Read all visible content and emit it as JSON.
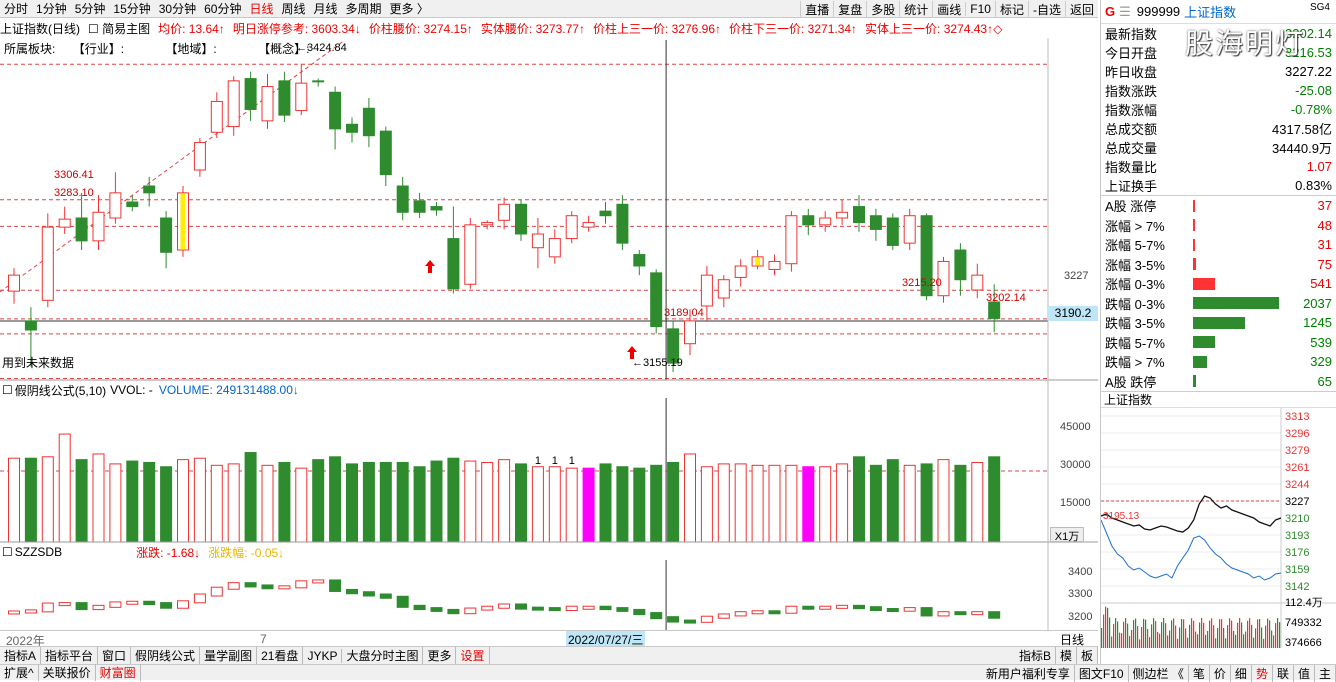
{
  "toolbar": {
    "periods": [
      "分时",
      "1分钟",
      "5分钟",
      "15分钟",
      "30分钟",
      "60分钟",
      "日线",
      "周线",
      "月线",
      "多周期",
      "更多 〉"
    ],
    "active_period": "日线",
    "right": [
      "直播",
      "复盘",
      "多股",
      "统计",
      "画线",
      "F10",
      "标记",
      "-自选",
      "返回"
    ]
  },
  "info": {
    "name": "上证指数(日线)",
    "chart_mode": "简易主图",
    "items": [
      {
        "text": "均价: 13.64↑",
        "color": "red"
      },
      {
        "text": "明日涨停参考: 3603.34↓",
        "color": "red"
      },
      {
        "text": "价柱腰价: 3274.15↑",
        "color": "red"
      },
      {
        "text": "实体腰价: 3273.77↑",
        "color": "red"
      },
      {
        "text": "价柱上三一价: 3276.96↑",
        "color": "red"
      },
      {
        "text": "价柱下三一价: 3271.34↑",
        "color": "red"
      },
      {
        "text": "实体上三一价: 3274.43↑◇",
        "color": "red"
      }
    ]
  },
  "sector": {
    "label": "所属板块:",
    "industry": "【行业】:",
    "region": "【地域】:",
    "concept": "【概念】:"
  },
  "main_notes": {
    "future_data": "用到未来数据",
    "crosshair_price": "3190.2",
    "axis_3227": "3227"
  },
  "annotations": {
    "high": "←3424.84",
    "low": "←3155.19",
    "l1": "3306.41",
    "l2": "3283.10",
    "l3": "3189.04",
    "l4": "3215.20",
    "l5": "3202.14"
  },
  "vol": {
    "title": "假阴线公式(5,10)",
    "vvol": "VVOL: -",
    "volume": "VOLUME: 249131488.00↓",
    "ticks": [
      "45000",
      "30000",
      "15000"
    ],
    "unit": "X1万",
    "marker": "1"
  },
  "szz": {
    "title": "SZZSDB",
    "change": "涨跌: -1.68↓",
    "change_pct": "涨跌幅: -0.05↓",
    "ticks": [
      "3400",
      "3300",
      "3200"
    ],
    "year": "2022年",
    "month": "7",
    "date": "2022/07/27/三",
    "period": "日线"
  },
  "bottom": {
    "tabs": [
      "指标A",
      "指标平台",
      "窗口",
      "假阴线公式",
      "量学副图",
      "21看盘",
      "JYKP",
      "大盘分时主图",
      "更多",
      "设置"
    ],
    "right_tabs": [
      "指标B",
      "模",
      "板"
    ],
    "tabs2": [
      "扩展^",
      "关联报价",
      "财富圈"
    ],
    "right2": [
      "新用户福利专享",
      "图文F10",
      "侧边栏 《",
      "笔",
      "价",
      "细",
      "势",
      "联",
      "值",
      "主"
    ]
  },
  "right_panel": {
    "code": "999999",
    "name": "上证指数",
    "g": "G",
    "tag": "SG4",
    "stats": [
      {
        "k": "最新指数",
        "v": "3202.14",
        "color": "green"
      },
      {
        "k": "今日开盘",
        "v": "3216.53",
        "color": "green"
      },
      {
        "k": "昨日收盘",
        "v": "3227.22",
        "color": "black"
      },
      {
        "k": "指数涨跌",
        "v": "-25.08",
        "color": "green"
      },
      {
        "k": "指数涨幅",
        "v": "-0.78%",
        "color": "green"
      },
      {
        "k": "总成交额",
        "v": "4317.58亿",
        "color": "black"
      },
      {
        "k": "总成交量",
        "v": "34440.9万",
        "color": "black"
      },
      {
        "k": "指数量比",
        "v": "1.07",
        "color": "red"
      },
      {
        "k": "上证换手",
        "v": "0.83%",
        "color": "black"
      }
    ],
    "breadth": [
      {
        "k": "A股 涨停",
        "v": "37",
        "color": "red",
        "w": 1.8
      },
      {
        "k": "涨幅 > 7%",
        "v": "48",
        "color": "red",
        "w": 2.3
      },
      {
        "k": "涨幅 5-7%",
        "v": "31",
        "color": "red",
        "w": 1.5
      },
      {
        "k": "涨幅 3-5%",
        "v": "75",
        "color": "red",
        "w": 3.6
      },
      {
        "k": "涨幅 0-3%",
        "v": "541",
        "color": "red",
        "w": 26
      },
      {
        "k": "跌幅 0-3%",
        "v": "2037",
        "color": "green",
        "w": 100
      },
      {
        "k": "跌幅 3-5%",
        "v": "1245",
        "color": "green",
        "w": 61
      },
      {
        "k": "跌幅 5-7%",
        "v": "539",
        "color": "green",
        "w": 26
      },
      {
        "k": "跌幅 > 7%",
        "v": "329",
        "color": "green",
        "w": 16
      },
      {
        "k": "A股 跌停",
        "v": "65",
        "color": "green",
        "w": 3
      }
    ],
    "mini_title": "上证指数",
    "mini_ticks": [
      "3313",
      "3296",
      "3279",
      "3261",
      "3244",
      "3227",
      "3210",
      "3193",
      "3176",
      "3159",
      "3142"
    ],
    "mini_left": "3195.13",
    "mini_vol_ticks": [
      "112.4万",
      "749332",
      "374666"
    ]
  },
  "chart_data": {
    "type": "candlestick",
    "price_range": [
      3150,
      3430
    ],
    "dashed_levels": [
      3306.41,
      3283.1,
      3227.22,
      3202.14,
      3189.04
    ],
    "crosshair_index": 39,
    "candles": [
      [
        3240,
        3226,
        3246,
        3215
      ],
      [
        3200,
        3192,
        3212,
        3160
      ],
      [
        3218,
        3282,
        3294,
        3212
      ],
      [
        3282,
        3289,
        3300,
        3276
      ],
      [
        3290,
        3270,
        3312,
        3262
      ],
      [
        3270,
        3295,
        3310,
        3262
      ],
      [
        3290,
        3312,
        3330,
        3285
      ],
      [
        3304,
        3300,
        3310,
        3296
      ],
      [
        3318,
        3312,
        3326,
        3300
      ],
      [
        3290,
        3260,
        3296,
        3246
      ],
      [
        3262,
        3312,
        3318,
        3256
      ],
      [
        3332,
        3356,
        3360,
        3326
      ],
      [
        3365,
        3392,
        3400,
        3360
      ],
      [
        3370,
        3410,
        3414,
        3362
      ],
      [
        3412,
        3385,
        3418,
        3375
      ],
      [
        3375,
        3405,
        3416,
        3368
      ],
      [
        3410,
        3380,
        3418,
        3374
      ],
      [
        3384,
        3408,
        3424.84,
        3380
      ],
      [
        3410,
        3410,
        3412,
        3405
      ],
      [
        3400,
        3368,
        3405,
        3350
      ],
      [
        3372,
        3365,
        3378,
        3356
      ],
      [
        3386,
        3362,
        3395,
        3352
      ],
      [
        3366,
        3328,
        3370,
        3318
      ],
      [
        3318,
        3295,
        3326,
        3288
      ],
      [
        3305,
        3295,
        3312,
        3290
      ],
      [
        3300,
        3297,
        3304,
        3292
      ],
      [
        3272,
        3228,
        3300,
        3224
      ],
      [
        3232,
        3284,
        3290,
        3228
      ],
      [
        3284,
        3286,
        3288,
        3280
      ],
      [
        3288,
        3302,
        3308,
        3280
      ],
      [
        3302,
        3276,
        3306,
        3270
      ],
      [
        3276,
        3264,
        3290,
        3246
      ],
      [
        3256,
        3272,
        3280,
        3250
      ],
      [
        3272,
        3292,
        3296,
        3268
      ],
      [
        3282,
        3286,
        3292,
        3278
      ],
      [
        3296,
        3292,
        3304,
        3285
      ],
      [
        3302,
        3268,
        3310,
        3262
      ],
      [
        3258,
        3248,
        3262,
        3240
      ],
      [
        3242,
        3195,
        3245,
        3189
      ],
      [
        3193,
        3163,
        3200,
        3155.19
      ],
      [
        3180,
        3200,
        3210,
        3170
      ],
      [
        3213,
        3240,
        3248,
        3200
      ],
      [
        3220,
        3236,
        3240,
        3212
      ],
      [
        3238,
        3248,
        3254,
        3230
      ],
      [
        3248,
        3256,
        3262,
        3245
      ],
      [
        3245,
        3252,
        3258,
        3240
      ],
      [
        3250,
        3292,
        3296,
        3243
      ],
      [
        3292,
        3284,
        3298,
        3275
      ],
      [
        3284,
        3290,
        3296,
        3278
      ],
      [
        3290,
        3295,
        3306,
        3284
      ],
      [
        3300,
        3286,
        3310,
        3278
      ],
      [
        3292,
        3280,
        3298,
        3270
      ],
      [
        3290,
        3266,
        3294,
        3262
      ],
      [
        3268,
        3292,
        3298,
        3262
      ],
      [
        3292,
        3222,
        3294,
        3218
      ],
      [
        3222,
        3252,
        3256,
        3216
      ],
      [
        3262,
        3236,
        3268,
        3222
      ],
      [
        3227,
        3240,
        3250,
        3220
      ],
      [
        3216.53,
        3202.14,
        3232,
        3190
      ]
    ],
    "candle_colors": {
      "0": "up",
      "10": "up",
      "31": "up",
      "32": "up",
      "40": "up",
      "41": "up",
      "42": "up",
      "45": "up",
      "48": "up",
      "53": "up",
      "55": "up",
      "57": "up"
    },
    "volumes": [
      29500,
      29500,
      30000,
      38000,
      29000,
      31000,
      27500,
      28500,
      28000,
      26500,
      29000,
      29500,
      27000,
      27500,
      31500,
      27000,
      28000,
      26000,
      29000,
      30000,
      27500,
      28000,
      28000,
      28000,
      26500,
      28500,
      29500,
      28500,
      28000,
      29000,
      27500,
      26500,
      26500,
      26000,
      26000,
      27500,
      26500,
      26000,
      27000,
      28000,
      31000,
      26500,
      27500,
      27500,
      27000,
      27000,
      27000,
      26500,
      26500,
      27500,
      30000,
      27000,
      29000,
      27000,
      27500,
      29000,
      27000,
      28000,
      30000
    ],
    "volume_colors": {
      "34": "magenta",
      "47": "magenta"
    },
    "volume_ref": 25000,
    "szz_values": [
      3225,
      3230,
      3260,
      3262,
      3240,
      3250,
      3265,
      3268,
      3262,
      3246,
      3270,
      3300,
      3330,
      3350,
      3340,
      3332,
      3336,
      3358,
      3362,
      3320,
      3310,
      3300,
      3290,
      3250,
      3240,
      3232,
      3222,
      3238,
      3246,
      3256,
      3242,
      3240,
      3236,
      3246,
      3246,
      3240,
      3232,
      3218,
      3200,
      3185,
      3184,
      3202,
      3212,
      3222,
      3226,
      3224,
      3246,
      3245,
      3246,
      3250,
      3244,
      3236,
      3233,
      3240,
      3212,
      3222,
      3218,
      3222,
      3202
    ]
  }
}
